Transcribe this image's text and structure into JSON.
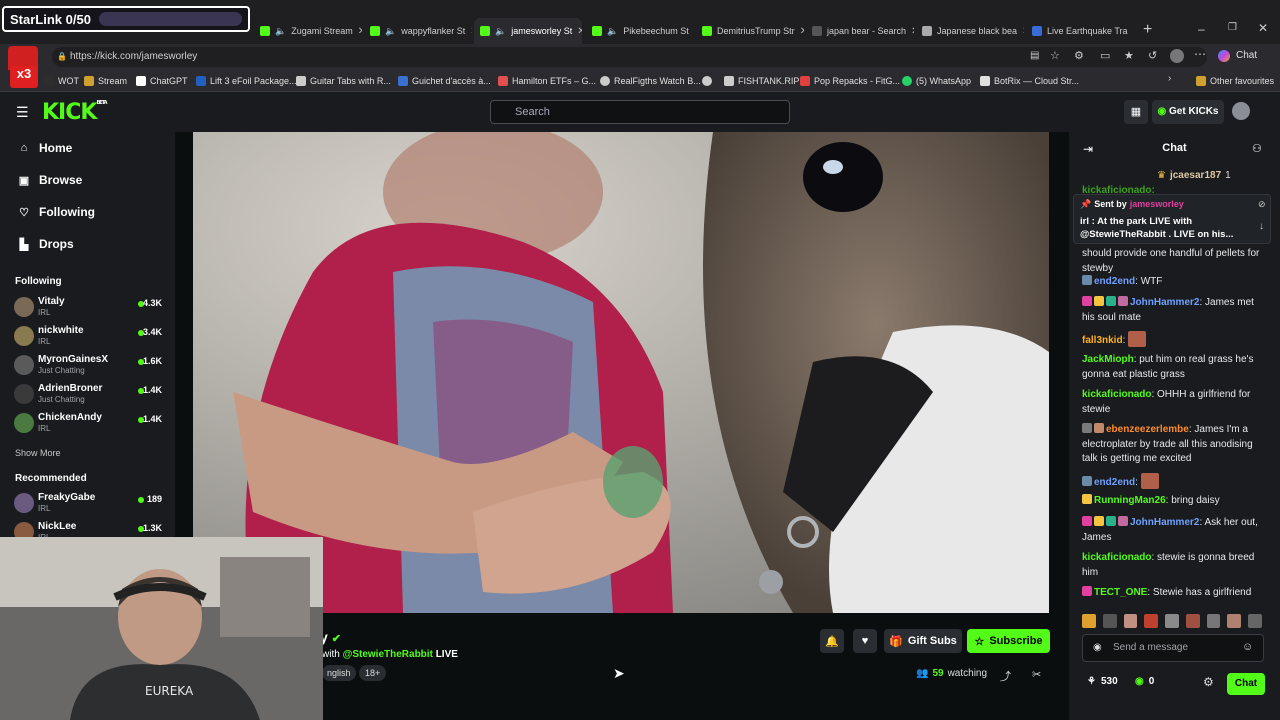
{
  "overlay": {
    "starlink": "StarLink 0/50"
  },
  "browser": {
    "tabs": [
      {
        "label": "Zugami Stream",
        "color": "#53fc18",
        "active": false
      },
      {
        "label": "wappyflanker St",
        "color": "#53fc18",
        "active": false
      },
      {
        "label": "jamesworley St",
        "color": "#53fc18",
        "active": true
      },
      {
        "label": "Pikebeechum St",
        "color": "#53fc18",
        "active": false
      },
      {
        "label": "DemitriusTrump Str",
        "color": "#53fc18",
        "active": false
      },
      {
        "label": "japan bear - Search",
        "color": "#888888",
        "active": false
      },
      {
        "label": "Japanese black bea",
        "color": "#aaaaaa",
        "active": false
      },
      {
        "label": "Live Earthquake Tra",
        "color": "#3a6bd8",
        "active": false
      }
    ],
    "url": "https://kick.com/jamesworley",
    "profile_label": "Chat",
    "bookmarks": [
      {
        "label": "WOT",
        "color": "#2d2d2d"
      },
      {
        "label": "Stream",
        "color": "#d0a030"
      },
      {
        "label": "ChatGPT",
        "color": "#ffffff"
      },
      {
        "label": "Lift 3 eFoil Package...",
        "color": "#2060c0"
      },
      {
        "label": "Guitar Tabs with R...",
        "color": "#cccccc"
      },
      {
        "label": "Guichet d'accès à...",
        "color": "#3a70d0"
      },
      {
        "label": "Hamilton ETFs – G...",
        "color": "#e05050"
      },
      {
        "label": "RealFigths Watch B...",
        "color": "#cccccc"
      },
      {
        "label": "FISHTANK.RIP",
        "color": "#cccccc"
      },
      {
        "label": "Pop Repacks - FitG...",
        "color": "#e04040"
      },
      {
        "label": "(5) WhatsApp",
        "color": "#25d366"
      },
      {
        "label": "BotRix — Cloud Str...",
        "color": "#e0e0e0"
      }
    ],
    "other_favourites": "Other favourites"
  },
  "kick": {
    "logo": "KICK",
    "logo_beta": "BETA",
    "search_placeholder": "Search",
    "get_kicks": "Get KICKs",
    "nav": [
      {
        "label": "Home",
        "icon": "home-icon"
      },
      {
        "label": "Browse",
        "icon": "browse-icon"
      },
      {
        "label": "Following",
        "icon": "heart-icon"
      },
      {
        "label": "Drops",
        "icon": "drops-icon"
      }
    ],
    "following_title": "Following",
    "following": [
      {
        "name": "Vitaly",
        "category": "IRL",
        "viewers": "4.3K",
        "avatar": "#7a6a55"
      },
      {
        "name": "nickwhite",
        "category": "IRL",
        "viewers": "3.4K",
        "avatar": "#8a7a50"
      },
      {
        "name": "MyronGainesX",
        "category": "Just Chatting",
        "viewers": "1.6K",
        "avatar": "#5a5a5a"
      },
      {
        "name": "AdrienBroner",
        "category": "Just Chatting",
        "viewers": "1.4K",
        "avatar": "#3a3a3a"
      },
      {
        "name": "ChickenAndy",
        "category": "IRL",
        "viewers": "1.4K",
        "avatar": "#4a7a40"
      }
    ],
    "show_more": "Show More",
    "recommended_title": "Recommended",
    "recommended": [
      {
        "name": "FreakyGabe",
        "category": "IRL",
        "viewers": "189",
        "avatar": "#6a5a80"
      },
      {
        "name": "NickLee",
        "category": "IRL",
        "viewers": "1.3K",
        "avatar": "#8a5a40"
      }
    ],
    "stream": {
      "name_fragment": "y",
      "title_with": "with",
      "title_mention": "@StewieTheRabbit",
      "title_live": "LIVE",
      "tag_language": "nglish",
      "tag_age": "18+",
      "viewers": "59",
      "watching": "watching",
      "gift_subs": "Gift Subs",
      "subscribe": "Subscribe"
    },
    "chat": {
      "title": "Chat",
      "top_gifter": "jcaesar187",
      "top_gifter_count": "1",
      "pinned_sent_by": "Sent by",
      "pinned_author": "jamesworley",
      "pinned_text": "irl : At the park LIVE with @StewieTheRabbit . LIVE on his...",
      "partial_top_user": "kickaficionado:",
      "partial_top_text": "should provide one handful of pellets for stewby",
      "messages": [
        {
          "user": "end2end",
          "color": "#6ea0ff",
          "text": "WTF"
        },
        {
          "user": "JohnHammer2",
          "color": "#6ea0ff",
          "text": "James met his soul mate"
        },
        {
          "user": "fall3nkid",
          "color": "#ffb020",
          "text": ""
        },
        {
          "user": "JackMioph",
          "color": "#53fc18",
          "text": "put him on real grass he's gonna eat plastic grass"
        },
        {
          "user": "kickaficionado",
          "color": "#53fc18",
          "text": "OHHH a girlfriend for stewie"
        },
        {
          "user": "ebenzeezerlembe",
          "color": "#ff8c2a",
          "text": "James I'm a electroplater by trade all this anodising talk is getting me excited"
        },
        {
          "user": "end2end",
          "color": "#6ea0ff",
          "text": ""
        },
        {
          "user": "RunningMan26",
          "color": "#53fc18",
          "text": "bring daisy"
        },
        {
          "user": "JohnHammer2",
          "color": "#6ea0ff",
          "text": "Ask her out, James"
        },
        {
          "user": "kickaficionado",
          "color": "#53fc18",
          "text": "stewie is gonna breed him"
        },
        {
          "user": "TECT_ONE",
          "color": "#53fc18",
          "text": "Stewie has a girlfriend"
        }
      ],
      "input_placeholder": "Send a message",
      "points": "530",
      "kicks": "0",
      "send_label": "Chat"
    }
  },
  "colors": {
    "accent": "#53fc18",
    "bg": "#0b0e0f",
    "panel": "#191b1f"
  }
}
